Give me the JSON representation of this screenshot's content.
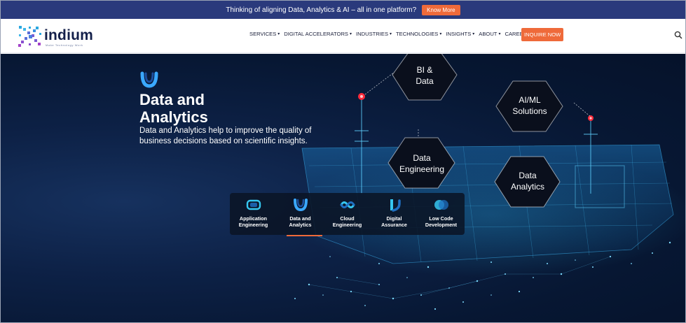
{
  "banner": {
    "text": "Thinking of aligning Data, Analytics & AI – all in one platform?",
    "button": "Know More"
  },
  "header": {
    "logo": {
      "word": "indium",
      "tagline": "Make Technology Work"
    },
    "nav": [
      {
        "label": "SERVICES",
        "caret": "▾"
      },
      {
        "label": "DIGITAL ACCELERATORS",
        "caret": "▾"
      },
      {
        "label": "INDUSTRIES",
        "caret": "▾"
      },
      {
        "label": "TECHNOLOGIES",
        "caret": "▾"
      },
      {
        "label": "INSIGHTS",
        "caret": "▾"
      },
      {
        "label": "ABOUT",
        "caret": "▾"
      },
      {
        "label": "CAREERS",
        "caret": ""
      }
    ],
    "inquire": "INQUIRE NOW",
    "search_icon": "search-icon"
  },
  "hero": {
    "title_line1": "Data and",
    "title_line2": "Analytics",
    "desc_line1": "Data and Analytics help to improve the quality of",
    "desc_line2": "business decisions based on scientific insights.",
    "hexagons": [
      {
        "line1": "BI &",
        "line2": "Data"
      },
      {
        "line1": "AI/ML",
        "line2": "Solutions"
      },
      {
        "line1": "Data",
        "line2": "Engineering"
      },
      {
        "line1": "Data",
        "line2": "Analytics"
      }
    ],
    "tabs": [
      {
        "line1": "Application",
        "line2": "Engineering",
        "icon": "app-engineering-icon",
        "active": false
      },
      {
        "line1": "Data and",
        "line2": "Analytics",
        "icon": "data-analytics-icon",
        "active": true
      },
      {
        "line1": "Cloud",
        "line2": "Engineering",
        "icon": "cloud-engineering-icon",
        "active": false
      },
      {
        "line1": "Digital",
        "line2": "Assurance",
        "icon": "digital-assurance-icon",
        "active": false
      },
      {
        "line1": "Low Code",
        "line2": "Development",
        "icon": "low-code-icon",
        "active": false
      }
    ]
  },
  "colors": {
    "accent": "#ef6a3a",
    "banner": "#2a3a7c",
    "hero_dark": "#071733"
  }
}
